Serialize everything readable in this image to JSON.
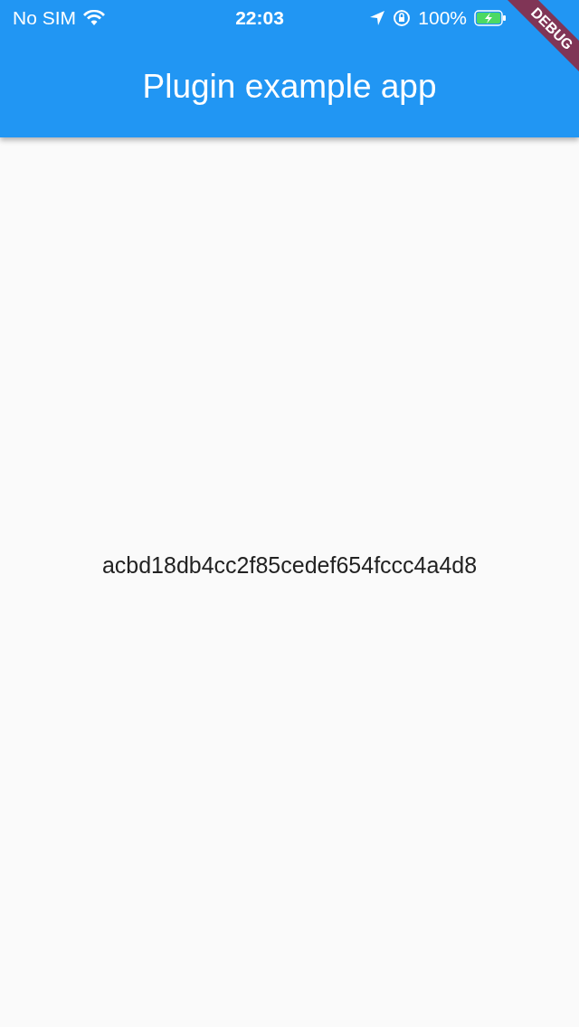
{
  "status_bar": {
    "carrier": "No SIM",
    "time": "22:03",
    "battery": "100%"
  },
  "app_bar": {
    "title": "Plugin example app"
  },
  "debug_banner": "DEBUG",
  "body": {
    "text": "acbd18db4cc2f85cedef654fccc4a4d8"
  }
}
